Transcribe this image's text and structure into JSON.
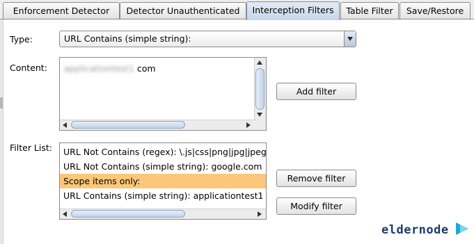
{
  "tabs": [
    {
      "label": "Enforcement Detector",
      "active": false
    },
    {
      "label": "Detector Unauthenticated",
      "active": false
    },
    {
      "label": "Interception Filters",
      "active": true
    },
    {
      "label": "Table Filter",
      "active": false
    },
    {
      "label": "Save/Restore",
      "active": false
    }
  ],
  "type": {
    "label": "Type:",
    "selected": "URL Contains (simple string):"
  },
  "content": {
    "label": "Content:",
    "text_blurred": "applicationtest1",
    "text_suffix": "com"
  },
  "buttons": {
    "add_filter": "Add filter",
    "remove_filter": "Remove filter",
    "modify_filter": "Modify filter"
  },
  "filter_list": {
    "label": "Filter List:",
    "items": [
      {
        "text": "URL Not Contains (regex): \\.js|css|png|jpg|jpeg",
        "selected": false
      },
      {
        "text": "URL Not Contains (simple string): google.com",
        "selected": false
      },
      {
        "text": "Scope items only:",
        "selected": true
      },
      {
        "text": "URL Contains (simple string): applicationtest1",
        "selected": false
      }
    ]
  },
  "watermark": {
    "text": "eldernode"
  },
  "colors": {
    "selected_row": "#fcc77a",
    "active_tab": "#c7d6ea",
    "logo_dark": "#1d3c67",
    "logo_accent": "#1fa6d6"
  }
}
